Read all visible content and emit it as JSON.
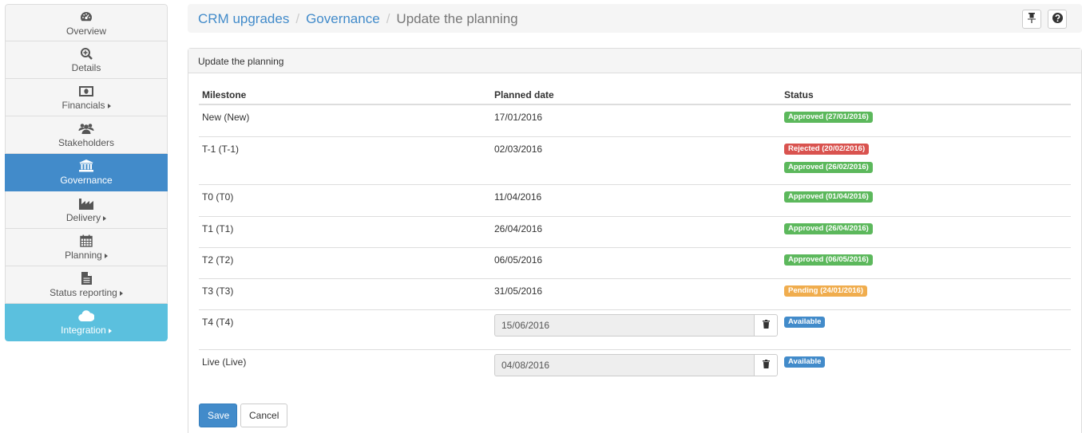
{
  "sidebar": {
    "items": [
      {
        "label": "Overview",
        "icon": "dashboard-icon",
        "caret": false
      },
      {
        "label": "Details",
        "icon": "zoom-in-icon",
        "caret": false
      },
      {
        "label": "Financials",
        "icon": "money-icon",
        "caret": true
      },
      {
        "label": "Stakeholders",
        "icon": "users-icon",
        "caret": false
      },
      {
        "label": "Governance",
        "icon": "bank-icon",
        "caret": false,
        "active": true
      },
      {
        "label": "Delivery",
        "icon": "factory-icon",
        "caret": true
      },
      {
        "label": "Planning",
        "icon": "calendar-icon",
        "caret": true
      },
      {
        "label": "Status reporting",
        "icon": "file-icon",
        "caret": true
      },
      {
        "label": "Integration",
        "icon": "cloud-icon",
        "caret": true
      }
    ]
  },
  "breadcrumb": {
    "project": "CRM upgrades",
    "section": "Governance",
    "sep": "/",
    "current": "Update the planning"
  },
  "toolbar": {
    "pin_icon": "pin-icon",
    "help_icon": "help-icon"
  },
  "panel": {
    "heading": "Update the planning",
    "columns": {
      "milestone": "Milestone",
      "planned_date": "Planned date",
      "status": "Status"
    },
    "rows": [
      {
        "milestone": "New (New)",
        "date": "17/01/2016",
        "statuses": [
          {
            "text": "Approved (27/01/2016)",
            "color": "green"
          }
        ]
      },
      {
        "milestone": "T-1 (T-1)",
        "date": "02/03/2016",
        "statuses": [
          {
            "text": "Rejected (20/02/2016)",
            "color": "red"
          },
          {
            "text": "Approved (26/02/2016)",
            "color": "green"
          }
        ]
      },
      {
        "milestone": "T0 (T0)",
        "date": "11/04/2016",
        "statuses": [
          {
            "text": "Approved (01/04/2016)",
            "color": "green"
          }
        ]
      },
      {
        "milestone": "T1 (T1)",
        "date": "26/04/2016",
        "statuses": [
          {
            "text": "Approved (26/04/2016)",
            "color": "green"
          }
        ]
      },
      {
        "milestone": "T2 (T2)",
        "date": "06/05/2016",
        "statuses": [
          {
            "text": "Approved (06/05/2016)",
            "color": "green"
          }
        ]
      },
      {
        "milestone": "T3 (T3)",
        "date": "31/05/2016",
        "statuses": [
          {
            "text": "Pending (24/01/2016)",
            "color": "orange"
          }
        ]
      },
      {
        "milestone": "T4 (T4)",
        "date_input": "15/06/2016",
        "statuses": [
          {
            "text": "Available",
            "color": "blue"
          }
        ]
      },
      {
        "milestone": "Live (Live)",
        "date_input": "04/08/2016",
        "statuses": [
          {
            "text": "Available",
            "color": "blue"
          }
        ]
      }
    ],
    "save_label": "Save",
    "cancel_label": "Cancel"
  },
  "colors": {
    "primary": "#428bca",
    "info": "#5bc0de",
    "success": "#5cb85c",
    "danger": "#d9534f",
    "warning": "#f0ad4e"
  }
}
